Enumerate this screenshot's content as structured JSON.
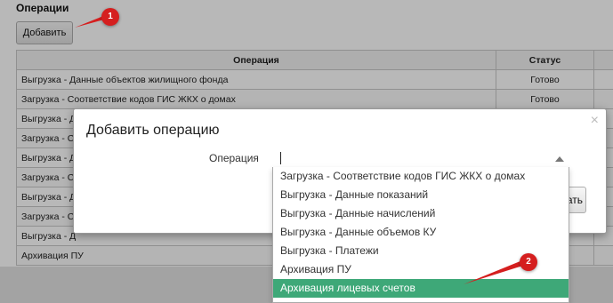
{
  "page": {
    "title": "Операции",
    "add_button": "Добавить"
  },
  "table": {
    "columns": [
      "Операция",
      "Статус"
    ],
    "rows": [
      {
        "operation": "Выгрузка - Данные объектов жилищного фонда",
        "status": "Готово"
      },
      {
        "operation": "Загрузка - Соответствие кодов ГИС ЖКХ о домах",
        "status": "Готово"
      },
      {
        "operation": "Выгрузка - Д",
        "status": ""
      },
      {
        "operation": "Загрузка - С",
        "status": ""
      },
      {
        "operation": "Выгрузка - Д",
        "status": ""
      },
      {
        "operation": "Загрузка - С",
        "status": ""
      },
      {
        "operation": "Выгрузка - Д",
        "status": ""
      },
      {
        "operation": "Загрузка - С",
        "status": ""
      },
      {
        "operation": "Выгрузка - Д",
        "status": ""
      },
      {
        "operation": "Архивация ПУ",
        "status": ""
      }
    ]
  },
  "dialog": {
    "title": "Добавить операцию",
    "close": "×",
    "field_label": "Операция",
    "field_value": "",
    "partial_button": "ать"
  },
  "dropdown": {
    "items": [
      "Загрузка - Соответствие кодов ГИС ЖКХ о домах",
      "Выгрузка - Данные показаний",
      "Выгрузка - Данные начислений",
      "Выгрузка - Данные объемов КУ",
      "Выгрузка - Платежи",
      "Архивация ПУ",
      "Архивация лицевых счетов"
    ],
    "selected_index": 6,
    "selected_color": "#3ea878"
  },
  "annotations": {
    "marker_1": "1",
    "marker_2": "2",
    "color": "#d51f1f"
  }
}
